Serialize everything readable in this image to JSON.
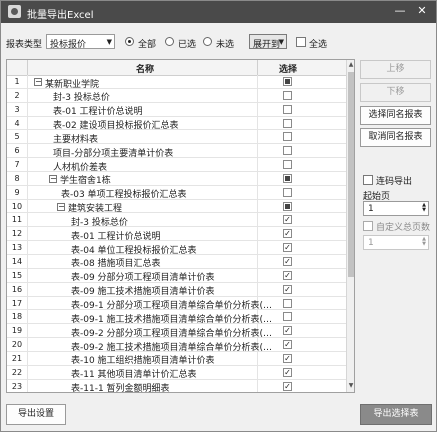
{
  "window": {
    "title": "批量导出Excel",
    "minimize_glyph": "—",
    "close_glyph": "✕"
  },
  "toolbar": {
    "type_label": "报表类型",
    "type_value": "投标报价",
    "filter_all": "全部",
    "filter_selected": "已选",
    "filter_unselected": "未选",
    "expand_label": "展开到",
    "select_all_label": "全选"
  },
  "grid": {
    "col_name": "名称",
    "col_select": "选择",
    "rows": [
      {
        "num": "1",
        "name": "某新职业学院",
        "level": 0,
        "toggle": "−",
        "state": "partial"
      },
      {
        "num": "2",
        "name": "封-3 投标总价",
        "level": 1,
        "state": "off"
      },
      {
        "num": "3",
        "name": "表-01 工程计价总说明",
        "level": 1,
        "state": "off"
      },
      {
        "num": "4",
        "name": "表-02 建设项目投标报价汇总表",
        "level": 1,
        "state": "off"
      },
      {
        "num": "5",
        "name": "主要材料表",
        "level": 1,
        "state": "off"
      },
      {
        "num": "6",
        "name": "项目-分部分项主要清单计价表",
        "level": 1,
        "state": "off"
      },
      {
        "num": "7",
        "name": "人材机价差表",
        "level": 1,
        "state": "off"
      },
      {
        "num": "8",
        "name": "学生宿舍1栋",
        "level": 1,
        "toggle": "−",
        "state": "partial"
      },
      {
        "num": "9",
        "name": "表-03 单项工程投标报价汇总表",
        "level": 2,
        "state": "off"
      },
      {
        "num": "10",
        "name": "建筑安装工程",
        "level": 2,
        "toggle": "−",
        "state": "partial"
      },
      {
        "num": "11",
        "name": "封-3 投标总价",
        "level": 3,
        "state": "on"
      },
      {
        "num": "12",
        "name": "表-01 工程计价总说明",
        "level": 3,
        "state": "on"
      },
      {
        "num": "13",
        "name": "表-04 单位工程投标报价汇总表",
        "level": 3,
        "state": "on"
      },
      {
        "num": "14",
        "name": "表-08 措施项目汇总表",
        "level": 3,
        "state": "on"
      },
      {
        "num": "15",
        "name": "表-09 分部分项工程项目清单计价表",
        "level": 3,
        "state": "on"
      },
      {
        "num": "16",
        "name": "表-09 施工技术措施项目清单计价表",
        "level": 3,
        "state": "on"
      },
      {
        "num": "17",
        "name": "表-09-1 分部分项工程项目清单综合单价分析表(…",
        "level": 3,
        "state": "off"
      },
      {
        "num": "18",
        "name": "表-09-1 施工技术措施项目清单综合单价分析表(…",
        "level": 3,
        "state": "off"
      },
      {
        "num": "19",
        "name": "表-09-2 分部分项工程项目清单综合单价分析表(…",
        "level": 3,
        "state": "on"
      },
      {
        "num": "20",
        "name": "表-09-2 施工技术措施项目清单综合单价分析表(…",
        "level": 3,
        "state": "on"
      },
      {
        "num": "21",
        "name": "表-10 施工组织措施项目清单计价表",
        "level": 3,
        "state": "on"
      },
      {
        "num": "22",
        "name": "表-11 其他项目清单计价汇总表",
        "level": 3,
        "state": "on"
      },
      {
        "num": "23",
        "name": "表-11-1 暂列金额明细表",
        "level": 3,
        "state": "on"
      }
    ]
  },
  "side": {
    "move_up": "上移",
    "move_down": "下移",
    "select_same": "选择同名报表",
    "cancel_same": "取消同名报表",
    "continuous_label": "连码导出",
    "start_page_label": "起始页",
    "start_page_value": "1",
    "custom_total_label": "自定义总页数",
    "custom_total_value": "1"
  },
  "footer": {
    "settings": "导出设置",
    "export": "导出选择表"
  },
  "icons": {
    "app": "excel-export-icon",
    "check": "✓",
    "dropdown": "▼",
    "spin_up": "▲",
    "spin_down": "▼",
    "scroll_up": "▲",
    "scroll_down": "▼"
  }
}
